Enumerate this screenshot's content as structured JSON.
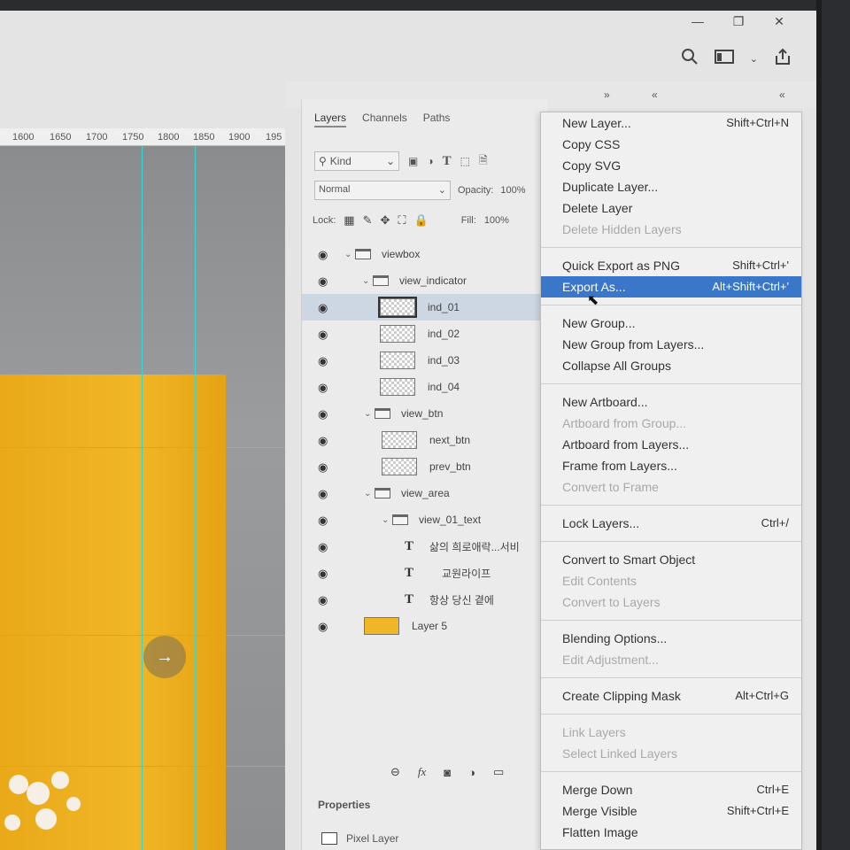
{
  "window": {
    "controls": [
      "—",
      "❐",
      "✕"
    ],
    "toolbar_icons": [
      "search-icon",
      "workspace-icon",
      "share-icon"
    ]
  },
  "ruler": {
    "ticks": [
      "1600",
      "1650",
      "1700",
      "1750",
      "1800",
      "1850",
      "1900",
      "195"
    ]
  },
  "canvas": {
    "arrow_glyph": "→",
    "accent_color": "#f0b626",
    "guide_color": "#38d5d5"
  },
  "layers_panel": {
    "tabs": [
      "Layers",
      "Channels",
      "Paths"
    ],
    "active_tab": "Layers",
    "filter_kind": "Kind",
    "blend_mode": "Normal",
    "opacity_label": "Opacity:",
    "opacity_value": "100%",
    "lock_label": "Lock:",
    "fill_label": "Fill:",
    "fill_value": "100%",
    "layers": [
      {
        "name": "viewbox",
        "type": "group",
        "indent": 0,
        "expanded": true
      },
      {
        "name": "view_indicator",
        "type": "group",
        "indent": 1,
        "expanded": true
      },
      {
        "name": "ind_01",
        "type": "pixel",
        "indent": 2,
        "selected": true
      },
      {
        "name": "ind_02",
        "type": "pixel",
        "indent": 2
      },
      {
        "name": "ind_03",
        "type": "pixel",
        "indent": 2
      },
      {
        "name": "ind_04",
        "type": "pixel",
        "indent": 2
      },
      {
        "name": "view_btn",
        "type": "group",
        "indent": 1,
        "expanded": true
      },
      {
        "name": "next_btn",
        "type": "pixel",
        "indent": 2
      },
      {
        "name": "prev_btn",
        "type": "pixel",
        "indent": 2
      },
      {
        "name": "view_area",
        "type": "group",
        "indent": 1,
        "expanded": true
      },
      {
        "name": "view_01_text",
        "type": "group",
        "indent": 2,
        "expanded": true
      },
      {
        "name": "삶의 희로애락...서비",
        "type": "text",
        "indent": 3
      },
      {
        "name": "교원라이프",
        "type": "text",
        "indent": 3
      },
      {
        "name": "항상 당신 곁에",
        "type": "text",
        "indent": 3
      },
      {
        "name": "Layer 5",
        "type": "image",
        "indent": 1
      }
    ],
    "properties_title": "Properties",
    "properties_type": "Pixel Layer"
  },
  "context_menu": {
    "sections": [
      [
        {
          "label": "New Layer...",
          "shortcut": "Shift+Ctrl+N",
          "enabled": true
        },
        {
          "label": "Copy CSS",
          "shortcut": "",
          "enabled": true
        },
        {
          "label": "Copy SVG",
          "shortcut": "",
          "enabled": true
        },
        {
          "label": "Duplicate Layer...",
          "shortcut": "",
          "enabled": true
        },
        {
          "label": "Delete Layer",
          "shortcut": "",
          "enabled": true
        },
        {
          "label": "Delete Hidden Layers",
          "shortcut": "",
          "enabled": false
        }
      ],
      [
        {
          "label": "Quick Export as PNG",
          "shortcut": "Shift+Ctrl+'",
          "enabled": true
        },
        {
          "label": "Export As...",
          "shortcut": "Alt+Shift+Ctrl+'",
          "enabled": true,
          "highlighted": true
        }
      ],
      [
        {
          "label": "New Group...",
          "shortcut": "",
          "enabled": true
        },
        {
          "label": "New Group from Layers...",
          "shortcut": "",
          "enabled": true
        },
        {
          "label": "Collapse All Groups",
          "shortcut": "",
          "enabled": true
        }
      ],
      [
        {
          "label": "New Artboard...",
          "shortcut": "",
          "enabled": true
        },
        {
          "label": "Artboard from Group...",
          "shortcut": "",
          "enabled": false
        },
        {
          "label": "Artboard from Layers...",
          "shortcut": "",
          "enabled": true
        },
        {
          "label": "Frame from Layers...",
          "shortcut": "",
          "enabled": true
        },
        {
          "label": "Convert to Frame",
          "shortcut": "",
          "enabled": false
        }
      ],
      [
        {
          "label": "Lock Layers...",
          "shortcut": "Ctrl+/",
          "enabled": true
        }
      ],
      [
        {
          "label": "Convert to Smart Object",
          "shortcut": "",
          "enabled": true
        },
        {
          "label": "Edit Contents",
          "shortcut": "",
          "enabled": false
        },
        {
          "label": "Convert to Layers",
          "shortcut": "",
          "enabled": false
        }
      ],
      [
        {
          "label": "Blending Options...",
          "shortcut": "",
          "enabled": true
        },
        {
          "label": "Edit Adjustment...",
          "shortcut": "",
          "enabled": false
        }
      ],
      [
        {
          "label": "Create Clipping Mask",
          "shortcut": "Alt+Ctrl+G",
          "enabled": true
        }
      ],
      [
        {
          "label": "Link Layers",
          "shortcut": "",
          "enabled": false
        },
        {
          "label": "Select Linked Layers",
          "shortcut": "",
          "enabled": false
        }
      ],
      [
        {
          "label": "Merge Down",
          "shortcut": "Ctrl+E",
          "enabled": true
        },
        {
          "label": "Merge Visible",
          "shortcut": "Shift+Ctrl+E",
          "enabled": true
        },
        {
          "label": "Flatten Image",
          "shortcut": "",
          "enabled": true
        }
      ]
    ]
  }
}
